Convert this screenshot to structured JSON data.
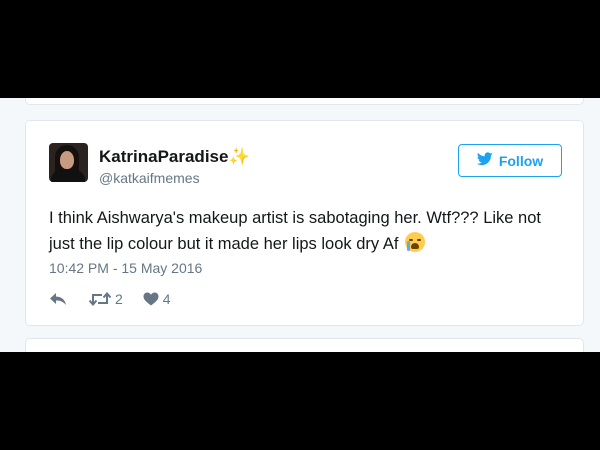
{
  "tweet": {
    "display_name": "KatrinaParadise✨",
    "handle": "@katkaifmemes",
    "follow_label": "Follow",
    "text": "I think Aishwarya's makeup artist is sabotaging her. Wtf??? Like not just the lip colour but it made her lips look dry Af",
    "timestamp": "10:42 PM - 15 May 2016",
    "retweet_count": "2",
    "like_count": "4"
  },
  "icons": {
    "follow": "twitter-bird-icon",
    "emoji": "loudly-crying-face-icon",
    "reply": "reply-icon",
    "retweet": "retweet-icon",
    "like": "heart-icon"
  },
  "colors": {
    "accent": "#1da1f2",
    "text": "#14171a",
    "muted": "#657786",
    "border": "#e1e8ed",
    "background": "#f5f8fa",
    "letterbox": "#000000"
  }
}
